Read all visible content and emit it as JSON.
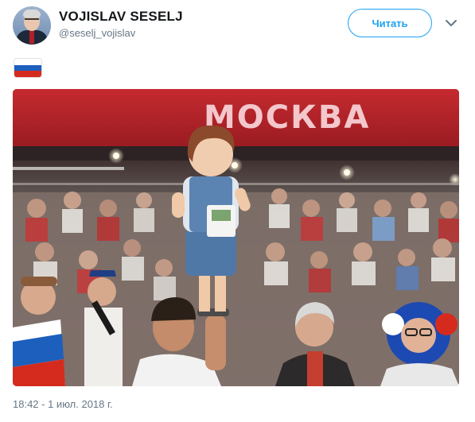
{
  "user": {
    "display_name": "VOJISLAV SESELJ",
    "handle": "@seselj_vojislav",
    "avatar_icon": "user-avatar"
  },
  "header": {
    "follow_label": "Читать",
    "menu_icon": "chevron-down-icon"
  },
  "tweet": {
    "emoji_icon": "russia-flag-emoji",
    "flag_colors": [
      "#ffffff",
      "#1c5fbd",
      "#d52b1e"
    ],
    "photo": {
      "banner_text": "МОСКВА"
    },
    "timestamp": "18:42 - 1 июл. 2018 г."
  },
  "colors": {
    "accent": "#1da1f2",
    "text_primary": "#14171a",
    "text_secondary": "#657786"
  }
}
